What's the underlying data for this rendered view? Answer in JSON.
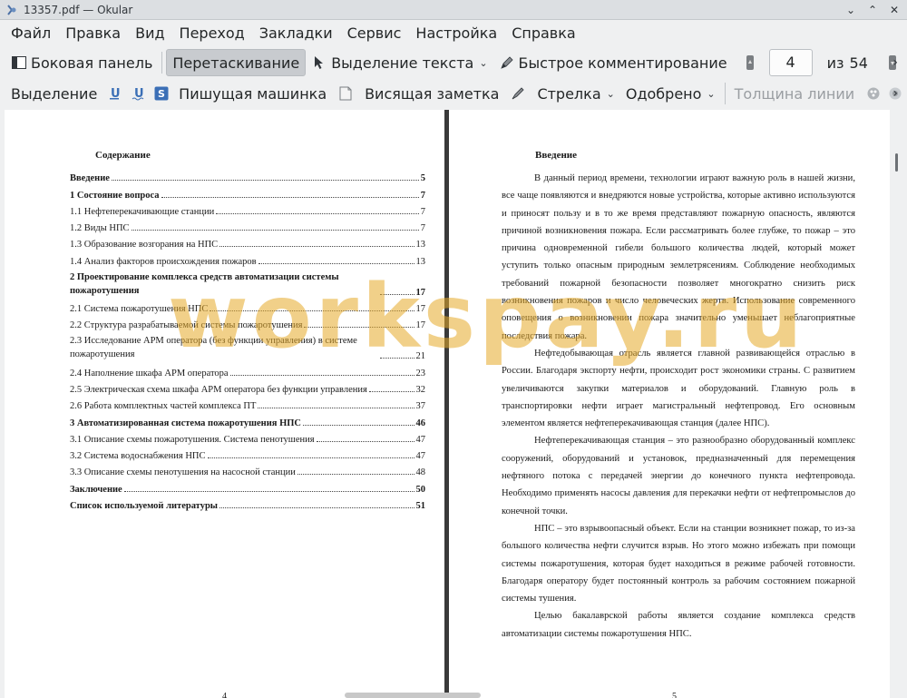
{
  "window": {
    "title": "13357.pdf  — Okular"
  },
  "menu": [
    "Файл",
    "Правка",
    "Вид",
    "Переход",
    "Закладки",
    "Сервис",
    "Настройка",
    "Справка"
  ],
  "toolbar1": {
    "sidebar": "Боковая панель",
    "browse": "Перетаскивание",
    "text_select": "Выделение текста",
    "quick_annotations": "Быстрое комментирование",
    "page_current": "4",
    "page_of": "из",
    "page_total": "54"
  },
  "toolbar2": {
    "highlight": "Выделение",
    "typewriter": "Пишущая машинка",
    "popup_note": "Висящая заметка",
    "arrow": "Стрелка",
    "stamp": "Одобрено",
    "line_width": "Толщина линии"
  },
  "left_page": {
    "heading": "Содержание",
    "toc": [
      {
        "t": "Введение",
        "p": "5",
        "bold": true
      },
      {
        "t": "1 Состояние вопроса",
        "p": "7",
        "bold": true
      },
      {
        "t": "1.1 Нефтеперекачивающие станции",
        "p": "7"
      },
      {
        "t": "1.2 Виды НПС",
        "p": "7"
      },
      {
        "t": "1.3 Образование возгорания на НПС",
        "p": "13"
      },
      {
        "t": "1.4 Анализ факторов происхождения пожаров",
        "p": "13"
      },
      {
        "t": "2 Проектирование комплекса средств автоматизации системы пожаротушения",
        "p": "17",
        "bold": true,
        "two": true
      },
      {
        "t": "2.1 Система пожаротушения НПС",
        "p": "17"
      },
      {
        "t": "2.2 Структура разрабатываемой системы пожаротушения",
        "p": "17"
      },
      {
        "t": "2.3 Исследование АРМ оператора (без функции управления) в системе пожаротушения",
        "p": "21",
        "two": true
      },
      {
        "t": "2.4 Наполнение шкафа АРМ оператора",
        "p": "23"
      },
      {
        "t": "2.5 Электрическая схема шкафа АРМ оператора без функции управления",
        "p": "32"
      },
      {
        "t": "2.6 Работа комплектных частей комплекса ПТ",
        "p": "37"
      },
      {
        "t": "3 Автоматизированная система пожаротушения НПС",
        "p": "46",
        "bold": true
      },
      {
        "t": "3.1 Описание схемы пожаротушения. Система пенотушения",
        "p": "47"
      },
      {
        "t": "3.2 Система водоснабжения НПС",
        "p": "47"
      },
      {
        "t": "3.3 Описание схемы пенотушения на насосной станции",
        "p": "48"
      },
      {
        "t": "Заключение",
        "p": "50",
        "bold": true
      },
      {
        "t": "Список используемой литературы",
        "p": "51",
        "bold": true
      }
    ],
    "page_number": "4"
  },
  "right_page": {
    "heading": "Введение",
    "paragraphs": [
      "В данный период времени, технологии играют важную роль в нашей жизни, все чаще появляются и внедряются новые устройства, которые активно используются и приносят пользу и в то же время представляют пожарную опасность, являются причиной возникновения пожара. Если рассматривать более глубже, то пожар – это причина одновременной гибели большого количества людей, который может уступить только опасным природным землетрясениям. Соблюдение необходимых требований пожарной безопасности позволяет многократно снизить риск возникновения пожаров и число человеческих жертв. Использование современного оповещения о возникновении пожара значительно уменьшает неблагоприятные последствия пожара.",
      "Нефтедобывающая отрасль является главной развивающейся отраслью в России. Благодаря экспорту нефти, происходит рост экономики страны. С развитием увеличиваются закупки материалов и оборудований. Главную роль в транспортировки нефти играет магистральный нефтепровод. Его основным элементом является нефтеперекачивающая станция (далее НПС).",
      "Нефтеперекачивающая станция – это разнообразно оборудованный комплекс сооружений, оборудований и установок, предназначенный для перемещения нефтяного потока с передачей энергии до конечного пункта нефтепровода. Необходимо применять насосы давления для перекачки нефти от нефтепромыслов до конечной точки.",
      "НПС – это взрывоопасный объект. Если на станции возникнет пожар, то из-за большого количества нефти случится взрыв. Но этого можно избежать при помощи системы пожаротушения, которая будет находиться в режиме рабочей готовности. Благодаря оператору будет постоянный контроль за рабочим состоянием пожарной системы тушения.",
      "Целью бакалаврской работы является создание комплекса средств автоматизации системы пожаротушения НПС."
    ],
    "page_number": "5"
  },
  "watermark": "workspay.ru",
  "colors": {
    "watermark": "#e6aa28",
    "active_tool": "#c8cbcf"
  }
}
